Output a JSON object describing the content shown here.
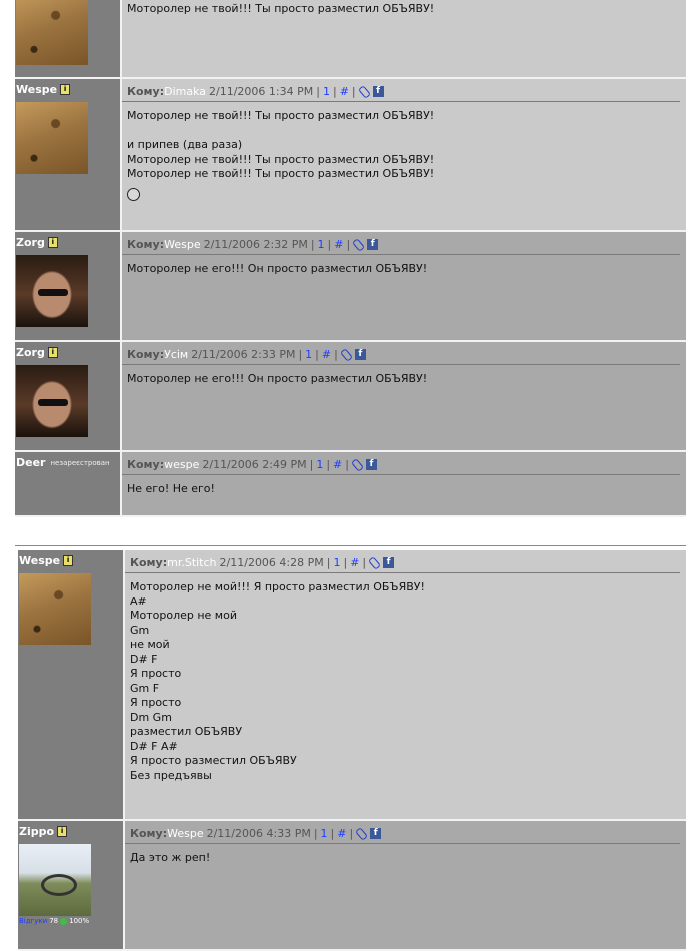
{
  "labels": {
    "komu": "Кому:",
    "link1": "1",
    "link_hash": "#",
    "info": "i",
    "fb": "f"
  },
  "posts_top": [
    {
      "user": "",
      "avatar": "wespe",
      "to": "",
      "date": "",
      "lines": [
        "Моторолер не твой!!! Ты просто разместил ОБЪЯВУ!"
      ],
      "partial": true
    },
    {
      "user": "Wespe",
      "avatar": "wespe",
      "to": "Dimaka",
      "date": "2/11/2006 1:34 PM",
      "lines": [
        "Моторолер не твой!!! Ты просто разместил ОБЪЯВУ!",
        "",
        "и припев (два раза)",
        "Моторолер не твой!!! Ты просто разместил ОБЪЯВУ!",
        "Моторолер не твой!!! Ты просто разместил ОБЪЯВУ!"
      ],
      "smiley": true
    },
    {
      "user": "Zorg",
      "avatar": "zorg",
      "to": "Wespe",
      "date": "2/11/2006 2:32 PM",
      "lines": [
        "Моторолер не его!!! Он просто разместил ОБЪЯВУ!"
      ]
    },
    {
      "user": "Zorg",
      "avatar": "zorg",
      "to": "Усім",
      "date": "2/11/2006 2:33 PM",
      "lines": [
        "Моторолер не его!!! Он просто разместил ОБЪЯВУ!"
      ]
    },
    {
      "user": "Deer",
      "guest": "незареєстрован",
      "avatar": "",
      "to": "wespe",
      "date": "2/11/2006 2:49 PM",
      "lines": [
        "Не его! Не его!"
      ]
    }
  ],
  "posts_bottom": [
    {
      "user": "Wespe",
      "avatar": "wespe",
      "to": "mr.Stitch",
      "date": "2/11/2006 4:28 PM",
      "lines": [
        "Моторолер не мой!!! Я просто разместил ОБЪЯВУ!",
        "A#",
        "Моторолер не мой",
        "Gm",
        "не мой",
        "D# F",
        "Я просто",
        "Gm F",
        "Я просто",
        "Dm Gm",
        "разместил ОБЪЯВУ",
        "D# F A#",
        "Я просто разместил ОБЪЯВУ",
        "Без предъявы"
      ]
    },
    {
      "user": "Zippo",
      "avatar": "zippo",
      "to": "Wespe",
      "date": "2/11/2006 4:33 PM",
      "lines": [
        "Да это ж реп!"
      ],
      "rating": {
        "link": "Відгуки",
        "count": "78",
        "percent": "100%"
      }
    }
  ]
}
